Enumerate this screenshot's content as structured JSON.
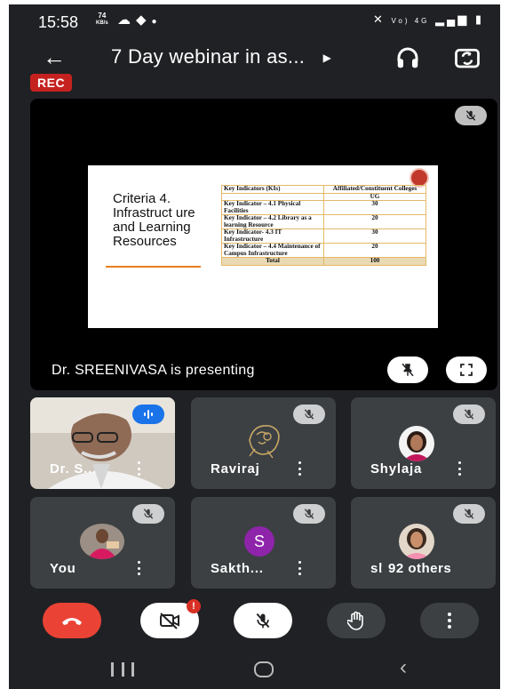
{
  "status_bar": {
    "time": "15:58",
    "speed_value": "74",
    "speed_unit": "KB/s",
    "signal_text": "Vo) 4G"
  },
  "header": {
    "title": "7 Day webinar in as...",
    "rec_badge": "REC"
  },
  "presentation": {
    "presenter_text": "Dr. SREENIVASA is presenting",
    "slide": {
      "heading": "Criteria 4. Infrastruct ure and Learning Resources",
      "table_header": [
        "Key Indicators (KIs)",
        "Affiliated/Constituent Colleges"
      ],
      "table_subheader": "UG",
      "rows": [
        {
          "indicator": "Key Indicator – 4.1 Physical Facilities",
          "value": "30"
        },
        {
          "indicator": "Key Indicator – 4.2 Library as a learning Resource",
          "value": "20"
        },
        {
          "indicator": "Key Indicator- 4.3 IT Infrastructure",
          "value": "30"
        },
        {
          "indicator": "Key Indicator – 4.4 Maintenance of Campus Infrastructure",
          "value": "20"
        }
      ],
      "total_label": "Total",
      "total_value": "100"
    }
  },
  "participants": [
    {
      "name": "Dr. S...",
      "muted": false,
      "speaking": true
    },
    {
      "name": "Raviraj",
      "muted": true
    },
    {
      "name": "Shylaja",
      "muted": true
    },
    {
      "name": "You",
      "muted": true
    },
    {
      "name": "Sakth...",
      "muted": true,
      "initial": "S",
      "avatar_color": "#8e24aa"
    },
    {
      "name": "sh",
      "muted": true,
      "others_label": "92 others"
    }
  ],
  "colors": {
    "background": "#202124",
    "tile": "#3c4043",
    "rec": "#c5221f",
    "end_call": "#ea4335",
    "notify": "#d93025"
  },
  "controls": [
    "end-call",
    "camera-off",
    "mic-off",
    "raise-hand",
    "more-options"
  ],
  "notification_badge": "!"
}
